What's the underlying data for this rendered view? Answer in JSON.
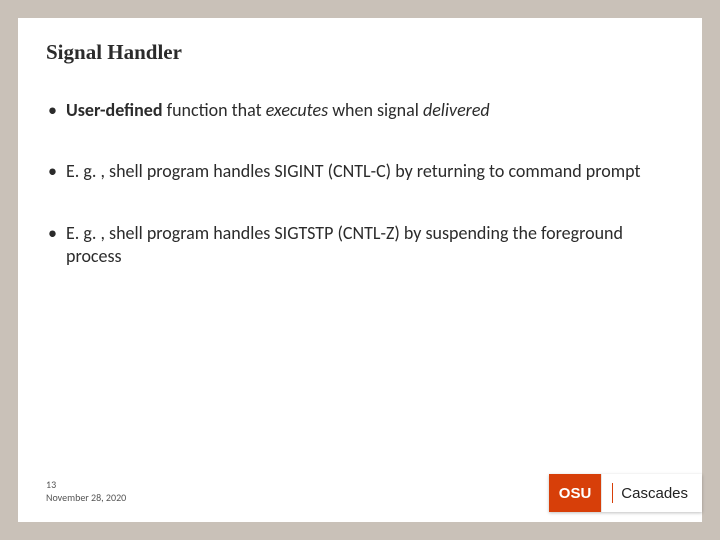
{
  "title": "Signal Handler",
  "bullets": [
    {
      "parts": {
        "a": "User-defined",
        "b": " function that ",
        "c": "executes",
        "d": " when signal ",
        "e": "delivered"
      }
    },
    {
      "text": "E. g. , shell program handles SIGINT (CNTL-C) by returning to command prompt"
    },
    {
      "text": "E. g. , shell program handles SIGTSTP (CNTL-Z) by suspending the foreground process"
    }
  ],
  "footer": {
    "slide_number": "13",
    "date": "November 28, 2020"
  },
  "logo": {
    "brand": "OSU",
    "campus": "Cascades"
  }
}
